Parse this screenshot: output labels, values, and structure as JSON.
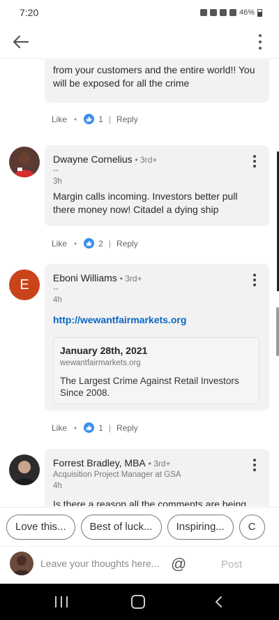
{
  "status_bar": {
    "time": "7:20",
    "battery": "46%"
  },
  "comments": [
    {
      "partial_text": "from your customers and the entire world!! You will be exposed for all the crime",
      "actions": {
        "like": "Like",
        "count": "1",
        "reply": "Reply"
      }
    },
    {
      "name": "Dwayne Cornelius",
      "degree": "• 3rd+",
      "headline": "--",
      "time": "3h",
      "text": "Margin calls incoming. Investors better pull there money now! Citadel a dying ship",
      "actions": {
        "like": "Like",
        "count": "2",
        "reply": "Reply"
      }
    },
    {
      "name": "Eboni Williams",
      "degree": "• 3rd+",
      "headline": "--",
      "time": "4h",
      "avatar_letter": "E",
      "link": "http://wewantfairmarkets.org",
      "preview": {
        "title": "January 28th, 2021",
        "domain": "wewantfairmarkets.org",
        "description": "The Largest Crime Against Retail Investors Since 2008."
      },
      "actions": {
        "like": "Like",
        "count": "1",
        "reply": "Reply"
      }
    },
    {
      "name": "Forrest Bradley, MBA",
      "degree": "• 3rd+",
      "headline": "Acquisition Project Manager at GSA",
      "time": "4h",
      "text": "Is there a reason all the comments are being"
    }
  ],
  "suggestions": [
    "Love this...",
    "Best of luck...",
    "Inspiring...",
    "C"
  ],
  "composer": {
    "placeholder": "Leave your thoughts here...",
    "at_symbol": "@",
    "post_label": "Post"
  },
  "colors": {
    "link": "#0a66c2",
    "like_badge": "#378fe9",
    "bubble": "#f2f2f2",
    "avatar_e": "#c9441b"
  }
}
